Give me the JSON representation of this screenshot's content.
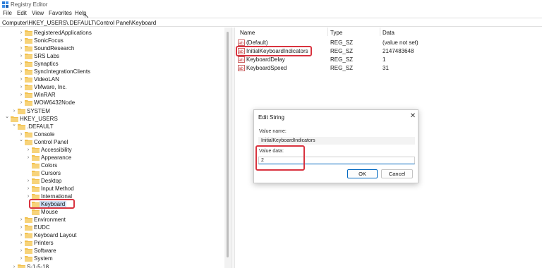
{
  "window": {
    "title": "Registry Editor"
  },
  "menu": [
    "File",
    "Edit",
    "View",
    "Favorites",
    "Help"
  ],
  "address": "Computer\\HKEY_USERS\\.DEFAULT\\Control Panel\\Keyboard",
  "tree": [
    {
      "label": "RegisteredApplications",
      "depth": 3,
      "expanded": false
    },
    {
      "label": "SonicFocus",
      "depth": 3,
      "expanded": false
    },
    {
      "label": "SoundResearch",
      "depth": 3,
      "expanded": false
    },
    {
      "label": "SRS Labs",
      "depth": 3,
      "expanded": false
    },
    {
      "label": "Synaptics",
      "depth": 3,
      "expanded": false
    },
    {
      "label": "SyncIntegrationClients",
      "depth": 3,
      "expanded": false
    },
    {
      "label": "VideoLAN",
      "depth": 3,
      "expanded": false
    },
    {
      "label": "VMware, Inc.",
      "depth": 3,
      "expanded": false
    },
    {
      "label": "WinRAR",
      "depth": 3,
      "expanded": false
    },
    {
      "label": "WOW6432Node",
      "depth": 3,
      "expanded": false
    },
    {
      "label": "SYSTEM",
      "depth": 2,
      "expanded": false
    },
    {
      "label": "HKEY_USERS",
      "depth": 1,
      "expanded": true
    },
    {
      "label": ".DEFAULT",
      "depth": 2,
      "expanded": true
    },
    {
      "label": "Console",
      "depth": 3,
      "expanded": false
    },
    {
      "label": "Control Panel",
      "depth": 3,
      "expanded": true
    },
    {
      "label": "Accessibility",
      "depth": 4,
      "expanded": false
    },
    {
      "label": "Appearance",
      "depth": 4,
      "expanded": false
    },
    {
      "label": "Colors",
      "depth": 4,
      "expanded": null
    },
    {
      "label": "Cursors",
      "depth": 4,
      "expanded": null
    },
    {
      "label": "Desktop",
      "depth": 4,
      "expanded": false
    },
    {
      "label": "Input Method",
      "depth": 4,
      "expanded": false
    },
    {
      "label": "International",
      "depth": 4,
      "expanded": false
    },
    {
      "label": "Keyboard",
      "depth": 4,
      "expanded": null,
      "selected": true
    },
    {
      "label": "Mouse",
      "depth": 4,
      "expanded": null
    },
    {
      "label": "Environment",
      "depth": 3,
      "expanded": false
    },
    {
      "label": "EUDC",
      "depth": 3,
      "expanded": false
    },
    {
      "label": "Keyboard Layout",
      "depth": 3,
      "expanded": false
    },
    {
      "label": "Printers",
      "depth": 3,
      "expanded": false
    },
    {
      "label": "Software",
      "depth": 3,
      "expanded": false
    },
    {
      "label": "System",
      "depth": 3,
      "expanded": false
    },
    {
      "label": "S-1-5-18",
      "depth": 2,
      "expanded": false
    }
  ],
  "values": {
    "headers": {
      "name": "Name",
      "type": "Type",
      "data": "Data"
    },
    "rows": [
      {
        "name": "(Default)",
        "type": "REG_SZ",
        "data": "(value not set)"
      },
      {
        "name": "InitialKeyboardIndicators",
        "type": "REG_SZ",
        "data": "2147483648"
      },
      {
        "name": "KeyboardDelay",
        "type": "REG_SZ",
        "data": "1"
      },
      {
        "name": "KeyboardSpeed",
        "type": "REG_SZ",
        "data": "31"
      }
    ]
  },
  "dialog": {
    "title": "Edit String",
    "close": "✕",
    "value_name_label": "Value name:",
    "value_name": "InitialKeyboardIndicators",
    "value_data_label": "Value data:",
    "value_data": "2",
    "ok_label": "OK",
    "cancel_label": "Cancel"
  },
  "colors": {
    "highlight": "#d9333f",
    "folder": "#f2c14e",
    "accent": "#0067c0"
  }
}
